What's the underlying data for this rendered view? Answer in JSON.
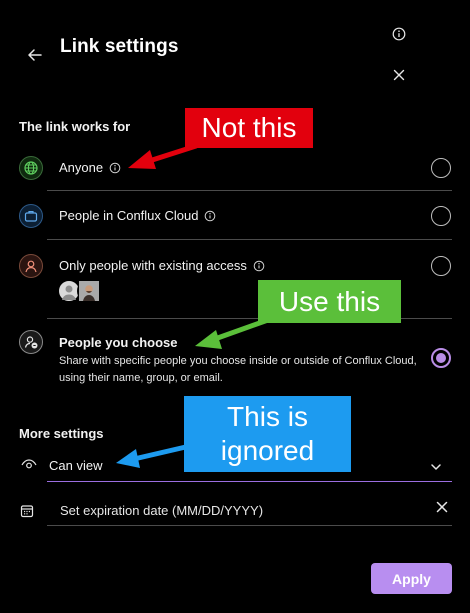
{
  "header": {
    "title": "Link settings"
  },
  "link_works_for": {
    "heading": "The link works for",
    "options": [
      {
        "label": "Anyone",
        "icon": "globe-icon",
        "selected": false
      },
      {
        "label": "People in Conflux Cloud",
        "icon": "briefcase-icon",
        "selected": false
      },
      {
        "label": "Only people with existing access",
        "icon": "person-icon",
        "selected": false
      },
      {
        "label": "People you choose",
        "icon": "person-lock-icon",
        "selected": true,
        "description": "Share with specific people you choose inside or outside of Conflux Cloud, using their name, group, or email."
      }
    ]
  },
  "more_settings": {
    "heading": "More settings",
    "permission": "Can view",
    "expiration_placeholder": "Set expiration date (MM/DD/YYYY)"
  },
  "footer": {
    "apply_label": "Apply"
  },
  "annotations": {
    "red": "Not this",
    "green": "Use this",
    "blue": "This is ignored"
  },
  "colors": {
    "background": "#000000",
    "accent": "#b88ef0",
    "divider": "#4b4b4b",
    "callout_red": "#e2000d",
    "callout_green": "#5bbf3a",
    "callout_blue": "#1d9bf0"
  }
}
